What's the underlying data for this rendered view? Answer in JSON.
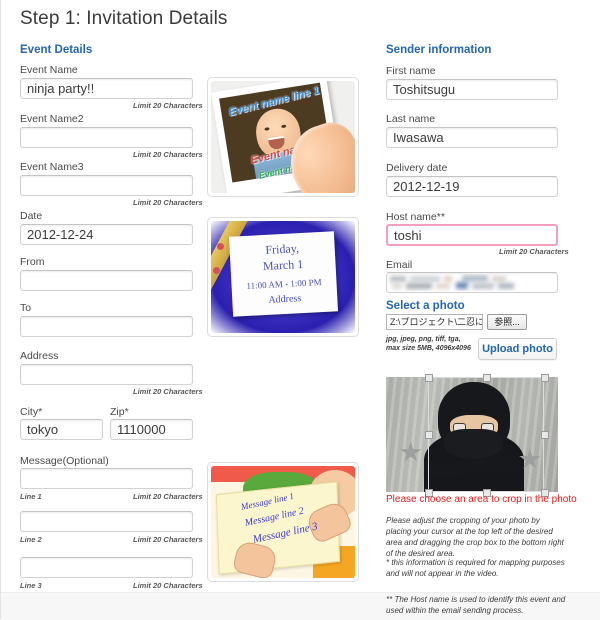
{
  "page": {
    "title": "Step 1: Invitation Details"
  },
  "event_details": {
    "heading": "Event Details",
    "limit_hint": "Limit 20 Characters",
    "fields": {
      "event_name": {
        "label": "Event Name",
        "value": "ninja party!!",
        "placeholder": ""
      },
      "event_name2": {
        "label": "Event Name2",
        "value": "",
        "placeholder": ""
      },
      "event_name3": {
        "label": "Event Name3",
        "value": "",
        "placeholder": ""
      },
      "date": {
        "label": "Date",
        "value": "2012-12-24",
        "placeholder": ""
      },
      "from": {
        "label": "From",
        "value": "",
        "placeholder": ""
      },
      "to": {
        "label": "To",
        "value": "",
        "placeholder": ""
      },
      "address": {
        "label": "Address",
        "value": "",
        "placeholder": ""
      },
      "city": {
        "label": "City*",
        "value": "tokyo",
        "placeholder": ""
      },
      "zip": {
        "label": "Zip*",
        "value": "1110000",
        "placeholder": ""
      }
    },
    "message": {
      "label": "Message(Optional)",
      "line1_label": "Line 1",
      "line2_label": "Line 2",
      "line3_label": "Line 3",
      "line1_value": "",
      "line2_value": "",
      "line3_value": ""
    }
  },
  "previews": {
    "event_card": {
      "line1": "Event name line 1",
      "line2": "Event name line 2",
      "line3": "Event name line 3"
    },
    "date_card": {
      "line1": "Friday,",
      "line2": "March 1",
      "line3": "11:00 AM - 1:00 PM",
      "line4": "Address"
    },
    "message_card": {
      "line1": "Message line 1",
      "line2": "Message line 2",
      "line3": "Message line 3"
    }
  },
  "sender_information": {
    "heading": "Sender information",
    "limit_hint": "Limit 20 Characters",
    "fields": {
      "first_name": {
        "label": "First name",
        "value": "Toshitsugu"
      },
      "last_name": {
        "label": "Last name",
        "value": "Iwasawa"
      },
      "delivery_date": {
        "label": "Delivery date",
        "value": "2012-12-19"
      },
      "host_name": {
        "label": "Host name**",
        "value": "toshi",
        "error": true
      },
      "email": {
        "label": "Email",
        "value": "",
        "redacted": true
      }
    }
  },
  "select_photo": {
    "heading": "Select a photo",
    "file_path": "Z:\\プロジェクト\\二忍に",
    "browse_label": "参照...",
    "format_hint": "jpg, jpeg, png, tiff, tga, max size 5MB, 4096x4096",
    "upload_label": "Upload photo"
  },
  "crop": {
    "warning": "Please choose an area to crop in the photo",
    "instructions": "Please adjust the cropping of your photo by placing your cursor at the top left of the desired area and dragging the crop box to the bottom right of the desired area.",
    "footnote_one": "* this information is required for mapping purposes and will not appear in the video.",
    "footnote_two": "** The Host name is used to identify this event and used within the email sending process."
  },
  "colors": {
    "accent_blue": "#2566b0",
    "error_red": "#e02020",
    "error_border": "#f2a0bd",
    "text": "#3b3b3b"
  }
}
